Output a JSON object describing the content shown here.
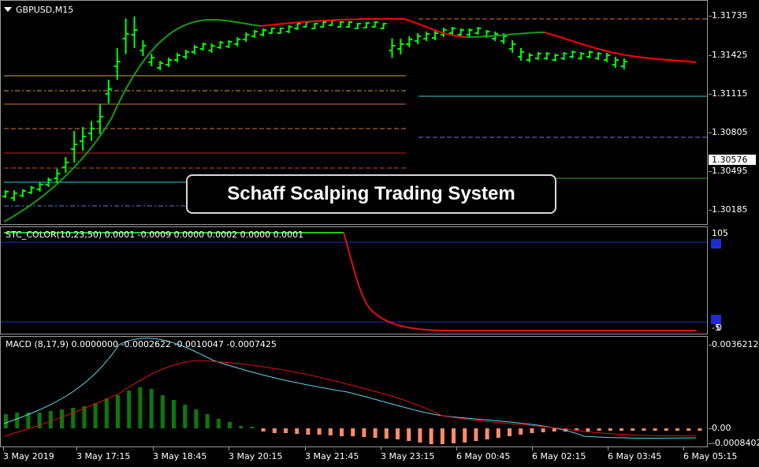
{
  "symbol": "GBPUSD,M15",
  "banner": "Schaff Scalping Trading System",
  "price_scale": [
    "1.31735",
    "1.31425",
    "1.31115",
    "1.30805",
    "1.30495",
    "1.30185"
  ],
  "current_price": "1.30576",
  "stc": {
    "label": "STC_COLOR(10,23,50) 0.0001 -0.0009 0.0000 0.0002 0.0000 0.0001",
    "scale_top": "105",
    "scale_bottom": "-5",
    "marker_low": "0"
  },
  "macd": {
    "label": "MACD  (8,17,9) 0.0000000 -0.0002622 -0.0010047 -0.0007425",
    "scale": [
      "0.0036212",
      "0.00",
      "-0.0008402"
    ]
  },
  "time_labels": [
    "3 May 2019",
    "3 May 17:15",
    "3 May 18:45",
    "3 May 20:15",
    "3 May 21:45",
    "3 May 23:15",
    "6 May 00:45",
    "6 May 02:15",
    "6 May 03:45",
    "6 May 05:15"
  ],
  "colors": {
    "background": "#000000",
    "bars": "#00ff00",
    "ma_up": "#1a9a1a",
    "ma_down": "#ff0000",
    "macd_hist_up": "#0a7a0a",
    "macd_hist_down": "#ff8c69",
    "macd_main": "#5fd3e6",
    "macd_signal": "#e01010"
  }
}
